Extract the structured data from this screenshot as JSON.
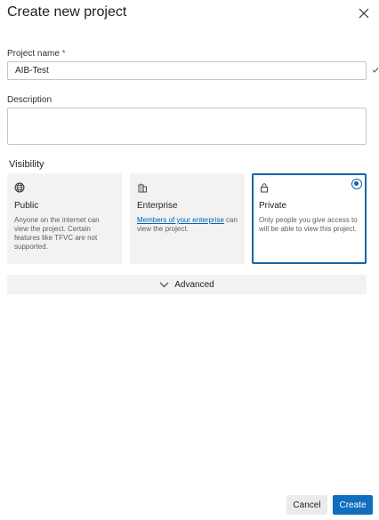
{
  "dialog": {
    "title": "Create new project",
    "close_icon": "close-icon"
  },
  "form": {
    "project_name_label": "Project name",
    "required_mark": "*",
    "project_name_value": "AIB-Test",
    "project_name_valid_icon": "checkmark-icon",
    "description_label": "Description",
    "description_value": ""
  },
  "visibility": {
    "title": "Visibility",
    "options": [
      {
        "title": "Public",
        "icon": "globe-icon",
        "description": "Anyone on the internet can view the project. Certain features like TFVC are not supported.",
        "selected": false
      },
      {
        "title": "Enterprise",
        "icon": "building-icon",
        "link_text": "Members of your enterprise",
        "description_rest": " can view the project.",
        "selected": false
      },
      {
        "title": "Private",
        "icon": "lock-icon",
        "description": "Only people you give access to will be able to view this project.",
        "selected": true
      }
    ]
  },
  "advanced": {
    "label": "Advanced",
    "icon": "chevron-down-icon"
  },
  "actions": {
    "cancel_label": "Cancel",
    "create_label": "Create"
  },
  "colors": {
    "accent": "#106ebe",
    "selected_border": "#1764a8",
    "card_bg": "#f3f2f1",
    "required": "#c4314b",
    "link": "#0063b1"
  }
}
